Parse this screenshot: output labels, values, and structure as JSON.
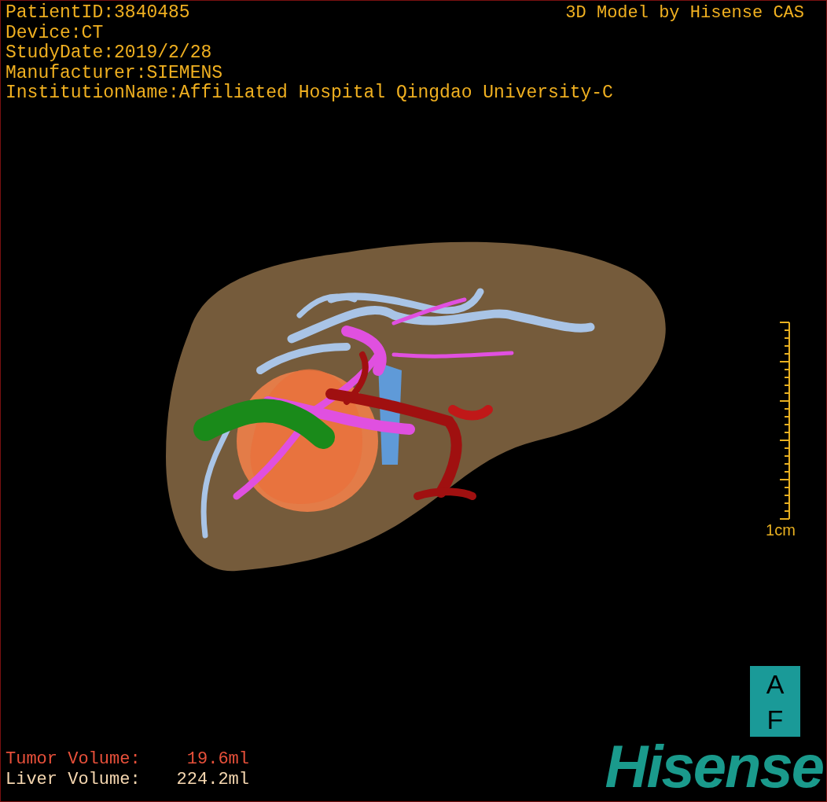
{
  "header": {
    "lines": [
      "PatientID:3840485",
      "Device:CT",
      "StudyDate:2019/2/28",
      "Manufacturer:SIEMENS",
      "InstitutionName:Affiliated Hospital Qingdao University-C"
    ],
    "credit": "3D Model by Hisense CAS"
  },
  "scale_bar": {
    "label": "1cm"
  },
  "orientation_cube": {
    "top": "A",
    "bottom": "F"
  },
  "volumes": [
    {
      "label": "Tumor Volume:",
      "value": "19.6ml",
      "color": "#e8503a"
    },
    {
      "label": "Liver Volume:",
      "value": "224.2ml",
      "color": "#f5d7b0"
    }
  ],
  "logo": "Hisense"
}
